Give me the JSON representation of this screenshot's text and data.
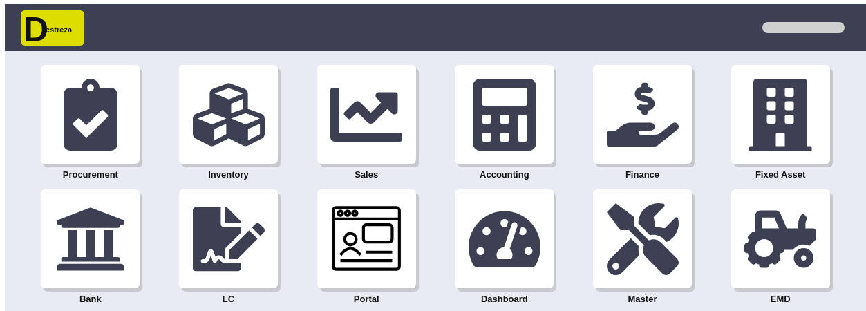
{
  "header": {
    "logo": {
      "letter": "D",
      "text": "estreza"
    }
  },
  "modules": [
    {
      "label": "Procurement"
    },
    {
      "label": "Inventory"
    },
    {
      "label": "Sales"
    },
    {
      "label": "Accounting"
    },
    {
      "label": "Finance"
    },
    {
      "label": "Fixed Asset"
    },
    {
      "label": "Bank"
    },
    {
      "label": "LC"
    },
    {
      "label": "Portal"
    },
    {
      "label": "Dashboard"
    },
    {
      "label": "Master"
    },
    {
      "label": "EMD"
    }
  ]
}
